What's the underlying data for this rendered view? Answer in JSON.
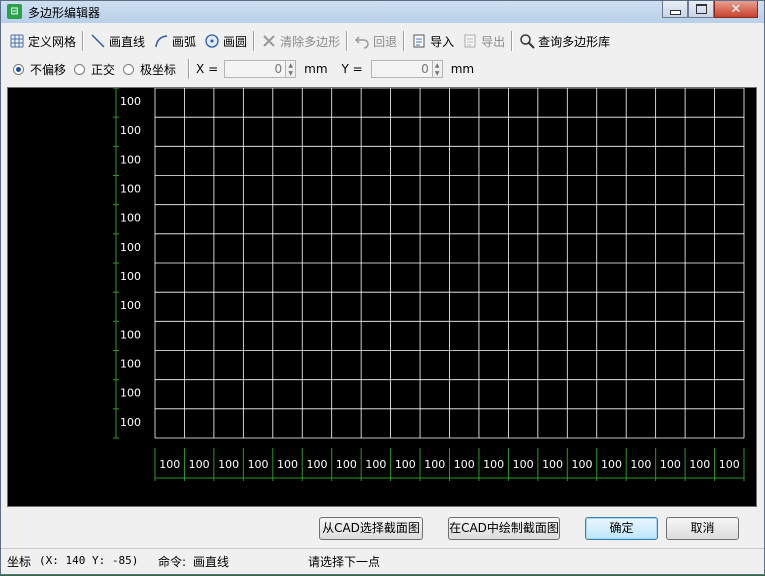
{
  "window": {
    "title": "多边形编辑器",
    "app_icon": "app-grid-icon"
  },
  "toolbar": {
    "items": [
      {
        "label": "定义网格",
        "icon": "grid-icon",
        "enabled": true
      },
      {
        "label": "画直线",
        "icon": "line-icon",
        "enabled": true
      },
      {
        "label": "画弧",
        "icon": "arc-icon",
        "enabled": true
      },
      {
        "label": "画圆",
        "icon": "circle-icon",
        "enabled": true
      },
      {
        "label": "清除多边形",
        "icon": "clear-icon",
        "enabled": false
      },
      {
        "label": "回退",
        "icon": "undo-icon",
        "enabled": false
      },
      {
        "label": "导入",
        "icon": "import-icon",
        "enabled": true
      },
      {
        "label": "导出",
        "icon": "export-icon",
        "enabled": false
      },
      {
        "label": "查询多边形库",
        "icon": "search-icon",
        "enabled": true
      }
    ]
  },
  "options": {
    "modes": [
      {
        "label": "不偏移",
        "selected": true
      },
      {
        "label": "正交",
        "selected": false
      },
      {
        "label": "极坐标",
        "selected": false
      }
    ],
    "x_label": "X =",
    "x_value": "0",
    "x_unit": "mm",
    "y_label": "Y =",
    "y_value": "0",
    "y_unit": "mm"
  },
  "grid": {
    "y_labels": [
      "100",
      "100",
      "100",
      "100",
      "100",
      "100",
      "100",
      "100",
      "100",
      "100",
      "100",
      "100"
    ],
    "x_labels": [
      "100",
      "100",
      "100",
      "100",
      "100",
      "100",
      "100",
      "100",
      "100",
      "100",
      "100",
      "100",
      "100",
      "100",
      "100",
      "100",
      "100",
      "100",
      "100",
      "100"
    ],
    "colors": {
      "background": "#000000",
      "grid": "#ffffff",
      "axis": "#2a9a2a"
    }
  },
  "buttons": {
    "select_from_cad": "从CAD选择截面图",
    "draw_in_cad": "在CAD中绘制截面图",
    "ok": "确定",
    "cancel": "取消"
  },
  "status": {
    "coord_label": "坐标",
    "coord_value": "(X: 140 Y: -85)",
    "command_label": "命令:",
    "command_value": "画直线",
    "prompt": "请选择下一点"
  }
}
